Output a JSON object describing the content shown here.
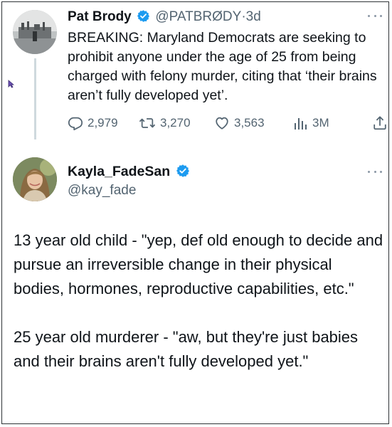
{
  "quoted_tweet": {
    "author_name": "Pat Brody",
    "handle": "@PATBRØDY",
    "separator": "·",
    "time": "3d",
    "text": "BREAKING: Maryland Democrats are seeking to prohibit anyone under the age of 25 from being charged with felony murder, citing that ‘their brains aren’t fully developed yet’.",
    "stats": {
      "replies": "2,979",
      "retweets": "3,270",
      "likes": "3,563",
      "views": "3M"
    }
  },
  "main_tweet": {
    "author_name": "Kayla_FadeSan",
    "handle": "@kay_fade",
    "paragraph_1": "13 year old child - \"yep, def old enough to decide and pursue an irreversible change in their physical bodies, hormones, reproductive capabilities, etc.\"",
    "paragraph_2": "25 year old murderer - \"aw, but they're just babies and their brains aren't fully developed yet.\""
  },
  "colors": {
    "verified": "#1d9bf0",
    "muted_text": "#536471",
    "thread_line": "#cfd9de"
  },
  "icons": [
    "reply-icon",
    "retweet-icon",
    "like-icon",
    "views-icon",
    "share-icon",
    "verified-badge-icon",
    "more-options-icon"
  ]
}
